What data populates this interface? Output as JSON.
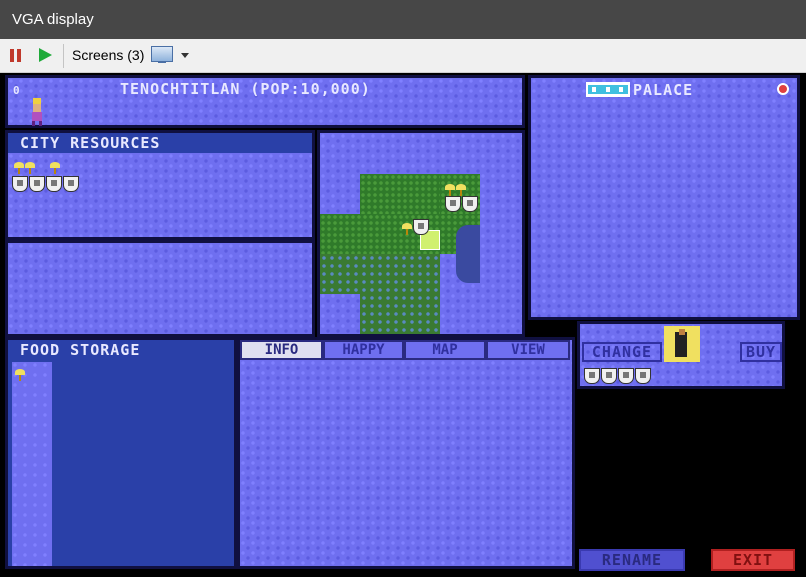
{
  "window": {
    "title": "VGA display"
  },
  "toolbar": {
    "screens_label": "Screens (3)"
  },
  "city": {
    "title": "TENOCHTITLAN (POP:10,000)",
    "corner_number": "0"
  },
  "resources": {
    "header": "CITY RESOURCES",
    "food_count": 3,
    "shield_count": 4
  },
  "food_storage": {
    "header": "FOOD STORAGE",
    "wheat_count": 1
  },
  "tabs": [
    {
      "label": "INFO",
      "active": true
    },
    {
      "label": "HAPPY",
      "active": false
    },
    {
      "label": "MAP",
      "active": false
    },
    {
      "label": "VIEW",
      "active": false
    }
  ],
  "production": {
    "label": "PALACE",
    "change_label": "CHANGE",
    "buy_label": "BUY",
    "shield_count": 4
  },
  "buttons": {
    "rename": "RENAME",
    "exit": "EXIT"
  },
  "colors": {
    "panel_blue": "#6f6ff0",
    "header_blue": "#2a40a8",
    "exit_red": "#e04040",
    "rename_blue": "#5050d0"
  }
}
